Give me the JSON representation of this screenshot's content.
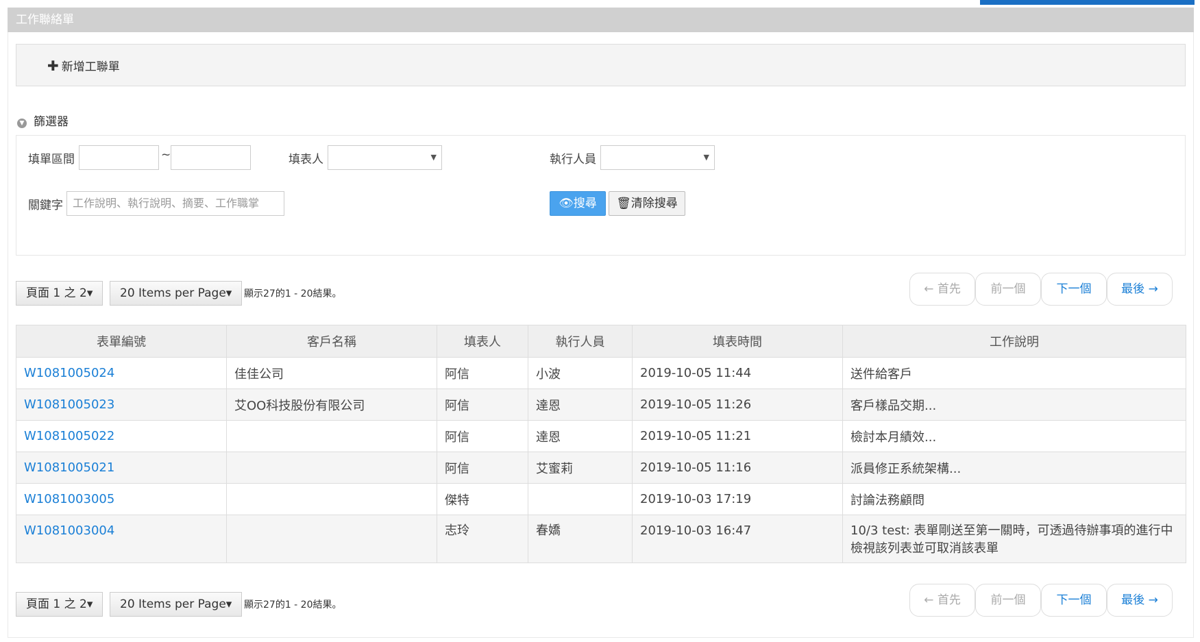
{
  "panel": {
    "title": "工作聯絡單"
  },
  "actions": {
    "add_label": "新增工聯單",
    "add_icon": "plus-icon"
  },
  "filter": {
    "toggle_label": "篩選器",
    "date_range_label": "填單區間",
    "date_separator": "~",
    "filler_label": "填表人",
    "executor_label": "執行人員",
    "keyword_label": "關鍵字",
    "keyword_placeholder": "工作說明、執行說明、摘要、工作職掌",
    "search_label": "搜尋",
    "clear_label": "清除搜尋"
  },
  "pager": {
    "page_label": "頁面 1 之 2",
    "per_page_label": "20 Items per Page",
    "info": "顯示27的1 - 20結果。",
    "first": "← 首先",
    "prev": "前一個",
    "next": "下一個",
    "last": "最後 →"
  },
  "table": {
    "headers": [
      "表單編號",
      "客戶名稱",
      "填表人",
      "執行人員",
      "填表時間",
      "工作說明"
    ],
    "rows": [
      [
        "W1081005024",
        "佳佳公司",
        "阿信",
        "小波",
        "2019-10-05 11:44",
        "送件給客戶"
      ],
      [
        "W1081005023",
        "艾OO科技股份有限公司",
        "阿信",
        "達恩",
        "2019-10-05 11:26",
        "客戶樣品交期..."
      ],
      [
        "W1081005022",
        "",
        "阿信",
        "達恩",
        "2019-10-05 11:21",
        "檢討本月績效..."
      ],
      [
        "W1081005021",
        "",
        "阿信",
        "艾蜜莉",
        "2019-10-05 11:16",
        "派員修正系統架構..."
      ],
      [
        "W1081003005",
        "",
        "傑特",
        "",
        "2019-10-03 17:19",
        "討論法務顧問"
      ],
      [
        "W1081003004",
        "",
        "志玲",
        "春嬌",
        "2019-10-03 16:47",
        "10/3 test: 表單剛送至第一關時，可透過待辦事項的進行中檢視該列表並可取消該表單"
      ]
    ]
  },
  "colors": {
    "accent": "#1a6fc4",
    "link": "#1a7fd6",
    "primary_button": "#4aa3ee",
    "header_bar": "#d0d0d0"
  }
}
